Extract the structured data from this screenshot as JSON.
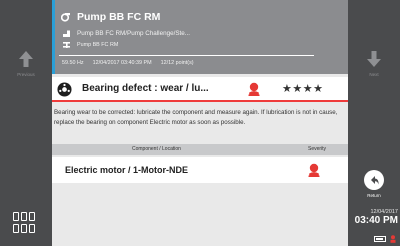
{
  "navigation": {
    "previous_label": "Previous",
    "next_label": "Next",
    "return_label": "Return"
  },
  "asset": {
    "title": "Pump BB FC RM",
    "path": "Pump BB FC RM/Pump Challenge/Ste...",
    "subtitle": "Pump BB FC RM",
    "meta": {
      "frequency": "59.50 Hz",
      "datetime": "12/04/2017 03:40:39 PM",
      "points": "12/12 point(s)"
    }
  },
  "defect": {
    "title": "Bearing defect : wear / lu...",
    "rating": "★★★★",
    "rating_value": 4,
    "severity_color": "#e53935"
  },
  "description": "Bearing wear to be corrected: lubricate the component and measure again. If lubrication is not in cause, replace the bearing on component Electric motor as soon as possible.",
  "table": {
    "headers": {
      "location": "Component / Location",
      "severity": "Severity"
    },
    "rows": [
      {
        "location": "Electric motor / 1-Motor-NDE"
      }
    ]
  },
  "status": {
    "date": "12/04/2017",
    "time": "03:40 PM"
  },
  "colors": {
    "accent": "#2a9fd6",
    "alert": "#e53935",
    "rail": "#4a4b4d",
    "header": "#8b8c8f"
  }
}
